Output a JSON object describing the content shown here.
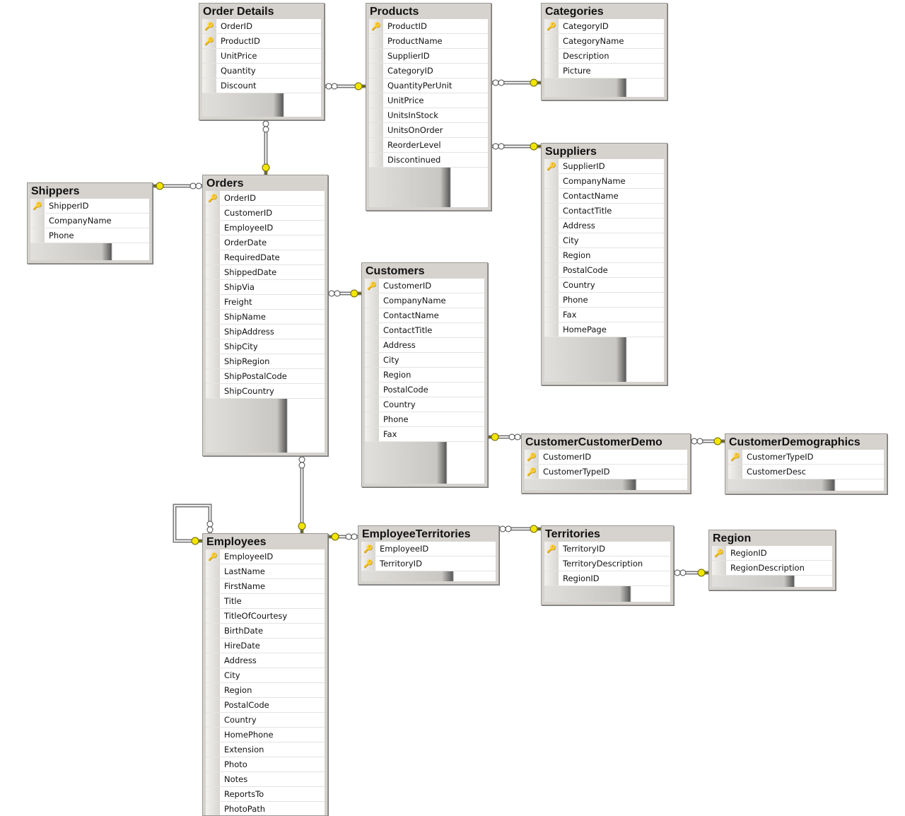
{
  "tables": [
    {
      "name": "Order Details",
      "fields": [
        {
          "n": "OrderID",
          "pk": true
        },
        {
          "n": "ProductID",
          "pk": true
        },
        {
          "n": "UnitPrice"
        },
        {
          "n": "Quantity"
        },
        {
          "n": "Discount"
        }
      ]
    },
    {
      "name": "Products",
      "fields": [
        {
          "n": "ProductID",
          "pk": true
        },
        {
          "n": "ProductName"
        },
        {
          "n": "SupplierID"
        },
        {
          "n": "CategoryID"
        },
        {
          "n": "QuantityPerUnit"
        },
        {
          "n": "UnitPrice"
        },
        {
          "n": "UnitsInStock"
        },
        {
          "n": "UnitsOnOrder"
        },
        {
          "n": "ReorderLevel"
        },
        {
          "n": "Discontinued"
        }
      ]
    },
    {
      "name": "Categories",
      "fields": [
        {
          "n": "CategoryID",
          "pk": true
        },
        {
          "n": "CategoryName"
        },
        {
          "n": "Description"
        },
        {
          "n": "Picture"
        }
      ]
    },
    {
      "name": "Suppliers",
      "fields": [
        {
          "n": "SupplierID",
          "pk": true
        },
        {
          "n": "CompanyName"
        },
        {
          "n": "ContactName"
        },
        {
          "n": "ContactTitle"
        },
        {
          "n": "Address"
        },
        {
          "n": "City"
        },
        {
          "n": "Region"
        },
        {
          "n": "PostalCode"
        },
        {
          "n": "Country"
        },
        {
          "n": "Phone"
        },
        {
          "n": "Fax"
        },
        {
          "n": "HomePage"
        }
      ]
    },
    {
      "name": "Shippers",
      "fields": [
        {
          "n": "ShipperID",
          "pk": true
        },
        {
          "n": "CompanyName"
        },
        {
          "n": "Phone"
        }
      ]
    },
    {
      "name": "Orders",
      "fields": [
        {
          "n": "OrderID",
          "pk": true
        },
        {
          "n": "CustomerID"
        },
        {
          "n": "EmployeeID"
        },
        {
          "n": "OrderDate"
        },
        {
          "n": "RequiredDate"
        },
        {
          "n": "ShippedDate"
        },
        {
          "n": "ShipVia"
        },
        {
          "n": "Freight"
        },
        {
          "n": "ShipName"
        },
        {
          "n": "ShipAddress"
        },
        {
          "n": "ShipCity"
        },
        {
          "n": "ShipRegion"
        },
        {
          "n": "ShipPostalCode"
        },
        {
          "n": "ShipCountry"
        }
      ]
    },
    {
      "name": "Customers",
      "fields": [
        {
          "n": "CustomerID",
          "pk": true
        },
        {
          "n": "CompanyName"
        },
        {
          "n": "ContactName"
        },
        {
          "n": "ContactTitle"
        },
        {
          "n": "Address"
        },
        {
          "n": "City"
        },
        {
          "n": "Region"
        },
        {
          "n": "PostalCode"
        },
        {
          "n": "Country"
        },
        {
          "n": "Phone"
        },
        {
          "n": "Fax"
        }
      ]
    },
    {
      "name": "CustomerCustomerDemo",
      "fields": [
        {
          "n": "CustomerID",
          "pk": true
        },
        {
          "n": "CustomerTypeID",
          "pk": true
        }
      ]
    },
    {
      "name": "CustomerDemographics",
      "fields": [
        {
          "n": "CustomerTypeID",
          "pk": true
        },
        {
          "n": "CustomerDesc"
        }
      ]
    },
    {
      "name": "Employees",
      "fields": [
        {
          "n": "EmployeeID",
          "pk": true
        },
        {
          "n": "LastName"
        },
        {
          "n": "FirstName"
        },
        {
          "n": "Title"
        },
        {
          "n": "TitleOfCourtesy"
        },
        {
          "n": "BirthDate"
        },
        {
          "n": "HireDate"
        },
        {
          "n": "Address"
        },
        {
          "n": "City"
        },
        {
          "n": "Region"
        },
        {
          "n": "PostalCode"
        },
        {
          "n": "Country"
        },
        {
          "n": "HomePhone"
        },
        {
          "n": "Extension"
        },
        {
          "n": "Photo"
        },
        {
          "n": "Notes"
        },
        {
          "n": "ReportsTo"
        },
        {
          "n": "PhotoPath"
        }
      ]
    },
    {
      "name": "EmployeeTerritories",
      "fields": [
        {
          "n": "EmployeeID",
          "pk": true
        },
        {
          "n": "TerritoryID",
          "pk": true
        }
      ]
    },
    {
      "name": "Territories",
      "fields": [
        {
          "n": "TerritoryID",
          "pk": true
        },
        {
          "n": "TerritoryDescription"
        },
        {
          "n": "RegionID"
        }
      ]
    },
    {
      "name": "Region",
      "fields": [
        {
          "n": "RegionID",
          "pk": true
        },
        {
          "n": "RegionDescription"
        }
      ]
    }
  ],
  "relationships": [
    {
      "many": "Order Details",
      "one": "Products"
    },
    {
      "many": "Products",
      "one": "Categories"
    },
    {
      "many": "Products",
      "one": "Suppliers"
    },
    {
      "many": "Order Details",
      "one": "Orders"
    },
    {
      "many": "Orders",
      "one": "Shippers"
    },
    {
      "many": "Orders",
      "one": "Customers"
    },
    {
      "many": "CustomerCustomerDemo",
      "one": "Customers"
    },
    {
      "many": "CustomerCustomerDemo",
      "one": "CustomerDemographics"
    },
    {
      "many": "Orders",
      "one": "Employees"
    },
    {
      "many": "Employees",
      "one": "Employees"
    },
    {
      "many": "EmployeeTerritories",
      "one": "Employees"
    },
    {
      "many": "EmployeeTerritories",
      "one": "Territories"
    },
    {
      "many": "Territories",
      "one": "Region"
    }
  ],
  "colors": {
    "key": "#f2e600",
    "line": "#8a8a8a",
    "table_bg": "#d6d3ce"
  }
}
